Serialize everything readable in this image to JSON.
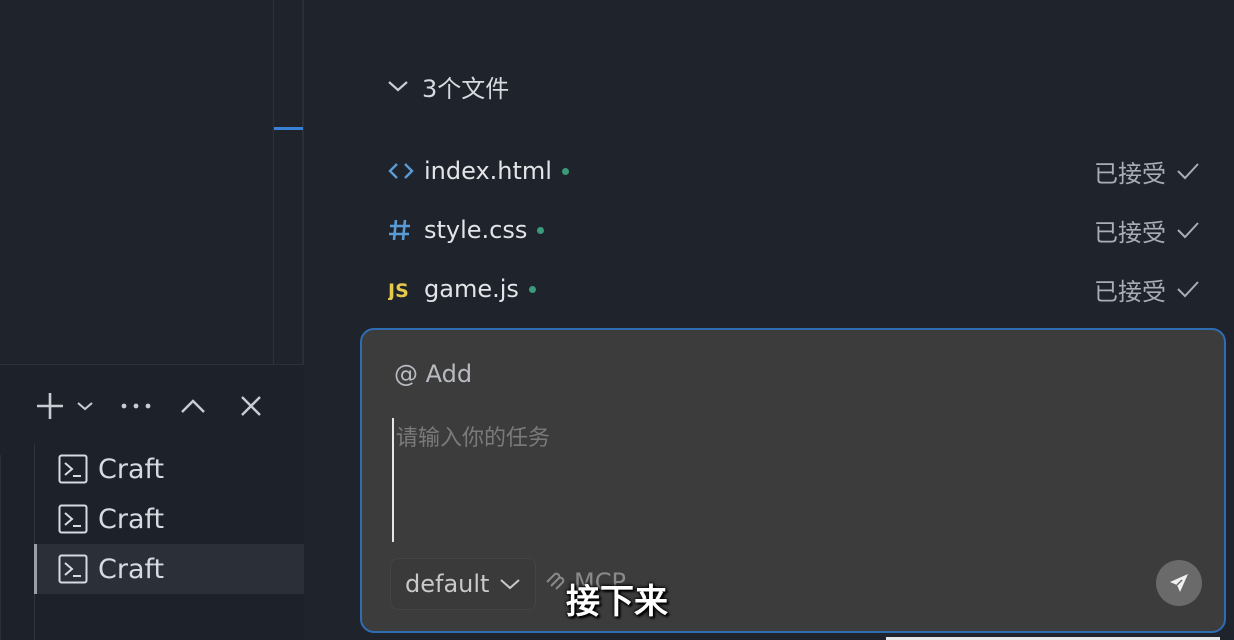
{
  "terminal_panel": {
    "items": [
      {
        "label": "Craft"
      },
      {
        "label": "Craft"
      },
      {
        "label": "Craft"
      }
    ]
  },
  "files": {
    "header": "3个文件",
    "list": [
      {
        "name": "index.html",
        "icon": "html-icon",
        "status": "已接受"
      },
      {
        "name": "style.css",
        "icon": "css-icon",
        "status": "已接受"
      },
      {
        "name": "game.js",
        "icon": "js-icon",
        "status": "已接受"
      }
    ]
  },
  "chat": {
    "add_label": "@ Add",
    "placeholder": "请输入你的任务",
    "mode": "default",
    "mcp_label": "MCP"
  },
  "subtitle": "接下来",
  "colors": {
    "accent": "#3b82d6",
    "chat_border": "#2f6db3",
    "file_dot": "#3b9a7a",
    "js_icon": "#e5c94b",
    "html_icon": "#5b9bd5",
    "css_icon": "#5b9bd5"
  }
}
